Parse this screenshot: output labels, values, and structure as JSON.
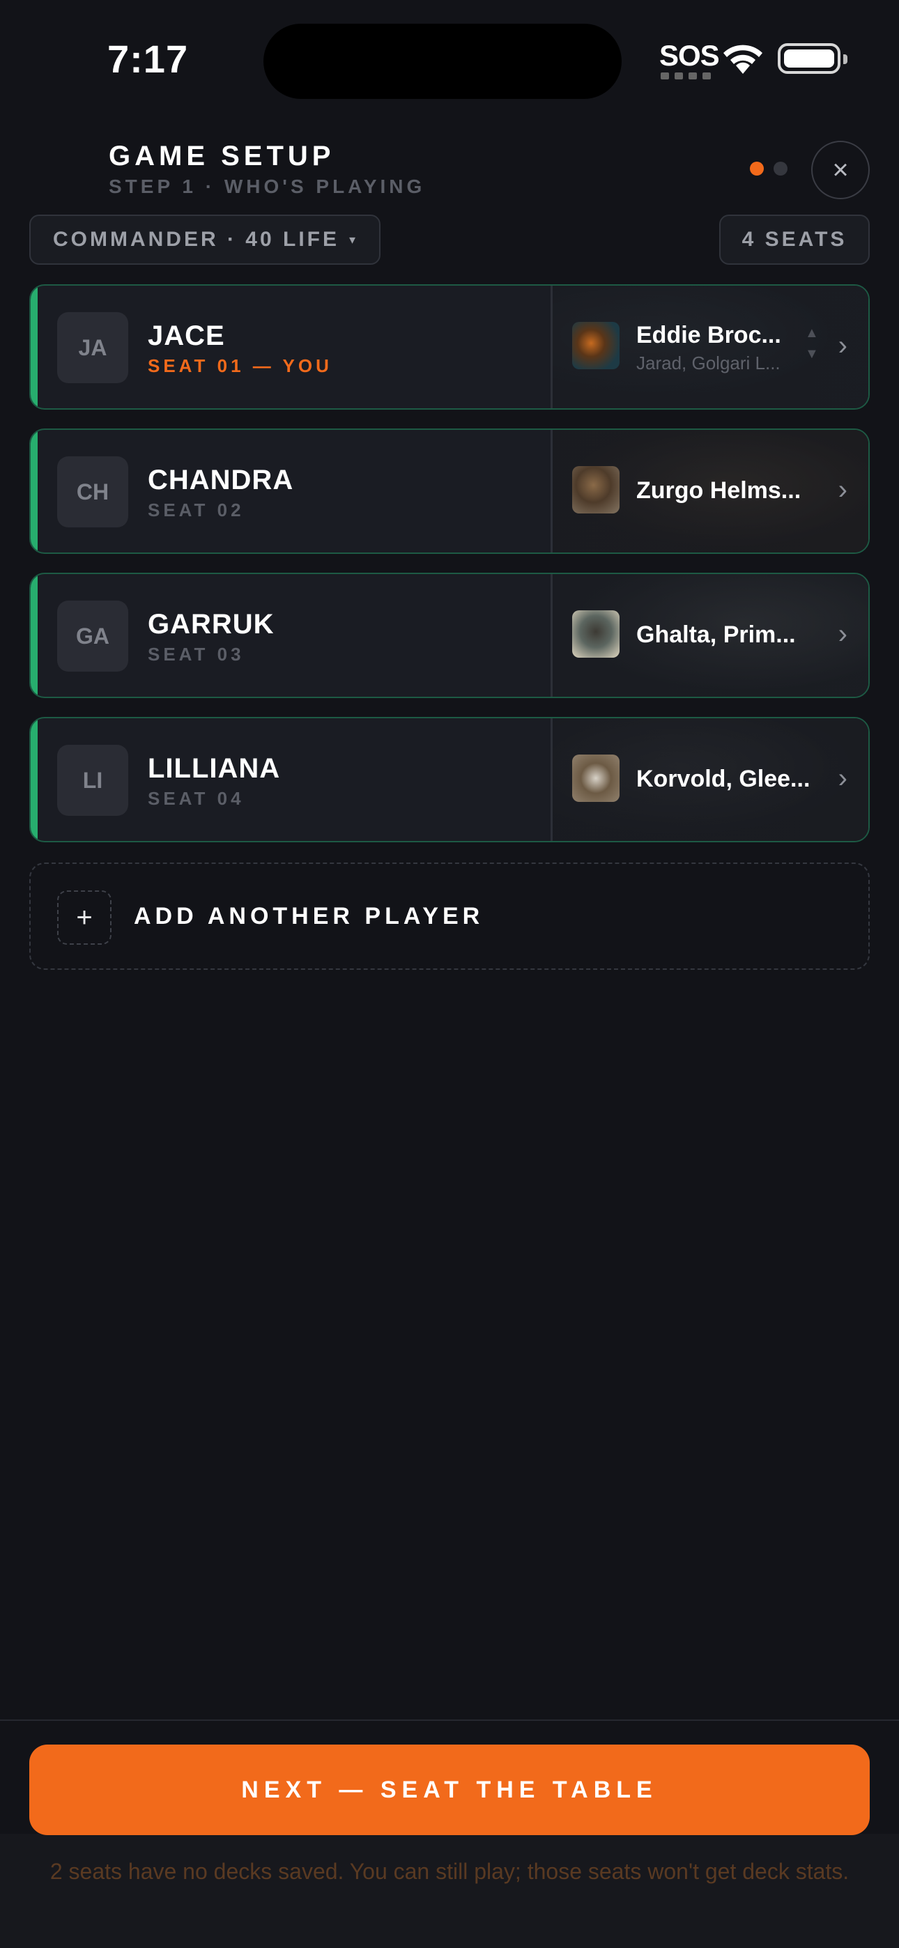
{
  "status_bar": {
    "time": "7:17",
    "sos": "SOS"
  },
  "header": {
    "title": "GAME SETUP",
    "subtitle": "STEP 1 · WHO'S PLAYING",
    "close_icon": "×",
    "step_total": 2,
    "step_active": 1
  },
  "mode_pill": {
    "label": "COMMANDER · 40 LIFE",
    "caret": "▾"
  },
  "seats_pill": {
    "label": "4 SEATS"
  },
  "players": [
    {
      "initials": "JA",
      "name": "JACE",
      "seat": "SEAT 01 — YOU",
      "deck_name": "Eddie Broc...",
      "deck_sub": "Jarad, Golgari L..."
    },
    {
      "initials": "CH",
      "name": "CHANDRA",
      "seat": "SEAT 02",
      "deck_name": "Zurgo Helms...",
      "deck_sub": ""
    },
    {
      "initials": "GA",
      "name": "GARRUK",
      "seat": "SEAT 03",
      "deck_name": "Ghalta, Prim...",
      "deck_sub": ""
    },
    {
      "initials": "LI",
      "name": "LILLIANA",
      "seat": "SEAT 04",
      "deck_name": "Korvold, Glee...",
      "deck_sub": ""
    }
  ],
  "add_player": {
    "plus": "+",
    "label": "ADD ANOTHER PLAYER"
  },
  "footer": {
    "next_label": "NEXT — SEAT THE TABLE",
    "warning": "2 seats have no decks saved. You can still play; those seats won't get deck stats."
  },
  "colors": {
    "accent": "#f26a1b",
    "card_border": "#1d5a44",
    "card_accent": "#27ae6e",
    "background": "#121318"
  }
}
